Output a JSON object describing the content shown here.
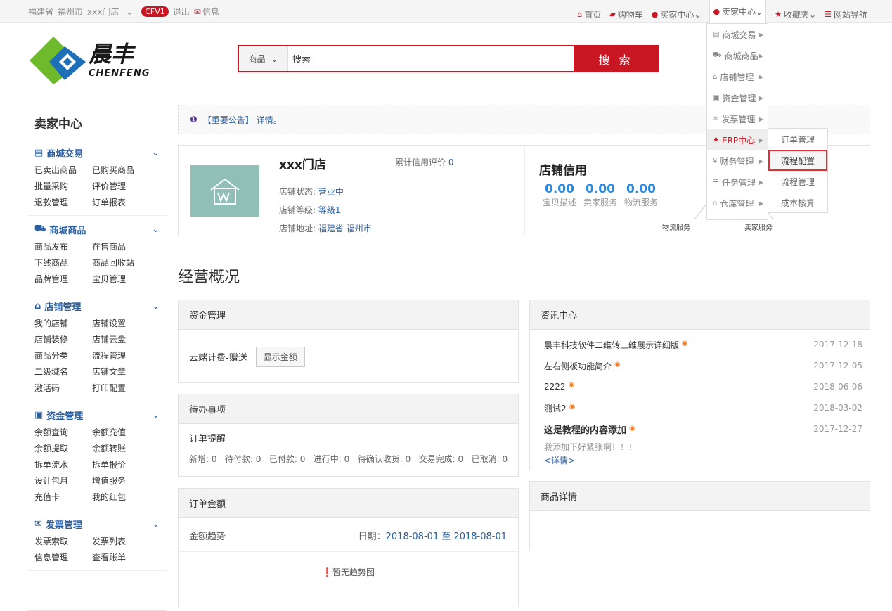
{
  "topbar": {
    "province": "福建省",
    "city": "福州市",
    "store": "xxx门店",
    "badge": "CFV1",
    "logout": "退出",
    "message": "信息",
    "home": "首页",
    "cart": "购物车",
    "buyer_center": "买家中心",
    "seller_center": "卖家中心",
    "favorites": "收藏夹",
    "site_nav": "网站导航"
  },
  "logo": {
    "cn": "晨丰",
    "en": "CHENFENG"
  },
  "search": {
    "category": "商品",
    "placeholder": "搜索",
    "button": "搜 索"
  },
  "sidebar": {
    "title": "卖家中心",
    "groups": [
      {
        "title": "商城交易",
        "icon": "list-icon",
        "links": [
          "已卖出商品",
          "已购买商品",
          "批量采购",
          "评价管理",
          "退款管理",
          "订单报表"
        ]
      },
      {
        "title": "商城商品",
        "icon": "truck-icon",
        "links": [
          "商品发布",
          "在售商品",
          "下线商品",
          "商品回收站",
          "品牌管理",
          "宝贝管理"
        ]
      },
      {
        "title": "店铺管理",
        "icon": "home-icon",
        "links": [
          "我的店铺",
          "店铺设置",
          "店铺装修",
          "店铺云盘",
          "商品分类",
          "流程管理",
          "二级域名",
          "店铺文章",
          "激活码",
          "打印配置"
        ]
      },
      {
        "title": "资金管理",
        "icon": "money-icon",
        "links": [
          "余额查询",
          "余额充值",
          "余额提取",
          "余额转账",
          "拆单流水",
          "拆单报价",
          "设计包月",
          "增值服务",
          "充值卡",
          "我的红包"
        ]
      },
      {
        "title": "发票管理",
        "icon": "envelope-icon",
        "links": [
          "发票索取",
          "发票列表",
          "信息管理",
          "查看账单"
        ]
      }
    ]
  },
  "notice": {
    "label": "【重要公告】",
    "link": "详情。"
  },
  "store": {
    "name": "xxx门店",
    "credit_total_label": "累计信用评价",
    "credit_total_value": "0",
    "status_label": "店铺状态:",
    "status_value": "营业中",
    "level_label": "店铺等级:",
    "level_value": "等级1",
    "address_label": "店铺地址:",
    "address_value": "福建省 福州市"
  },
  "credit": {
    "title": "店铺信用",
    "scores": [
      {
        "value": "0.00",
        "label": "宝贝描述"
      },
      {
        "value": "0.00",
        "label": "卖家服务"
      },
      {
        "value": "0.00",
        "label": "物流服务"
      }
    ],
    "chart_labels": [
      "物流服务",
      "卖家服务"
    ]
  },
  "overview_title": "经营概况",
  "funds_panel": {
    "title": "资金管理",
    "text": "云端计费-赠送",
    "button": "显示金额"
  },
  "todo_panel": {
    "title": "待办事项",
    "subtitle": "订单提醒",
    "stats": "新增: 0   待付款: 0   已付款: 0   进行中: 0   待确认收货: 0   交易完成: 0   已取消: 0"
  },
  "order_panel": {
    "title": "订单金额",
    "trend": "金额趋势",
    "date_label": "日期：",
    "date_value": "2018-08-01 至 2018-08-01",
    "empty": "暂无趋势图"
  },
  "news_panel": {
    "title": "资讯中心",
    "items": [
      {
        "title": "晨丰科技软件二维转三维展示详细版",
        "date": "2017-12-18"
      },
      {
        "title": "左右侧板功能简介",
        "date": "2017-12-05"
      },
      {
        "title": "2222",
        "date": "2018-06-06"
      },
      {
        "title": "测试2",
        "date": "2018-03-02"
      },
      {
        "title": "这是教程的内容添加",
        "date": "2017-12-27"
      }
    ],
    "summary": "我添加下好紧张啊！！！",
    "more": "<详情>"
  },
  "product_panel": {
    "title": "商品详情"
  },
  "dropdown": {
    "items": [
      "商城交易",
      "商城商品",
      "店铺管理",
      "资金管理",
      "发票管理",
      "ERP中心",
      "财务管理",
      "任务管理",
      "仓库管理"
    ],
    "submenu": [
      "订单管理",
      "流程配置",
      "流程管理",
      "成本核算"
    ]
  },
  "colors": {
    "brand": "#c81623",
    "link": "#2a5e9f",
    "score": "#2a8ae0"
  }
}
